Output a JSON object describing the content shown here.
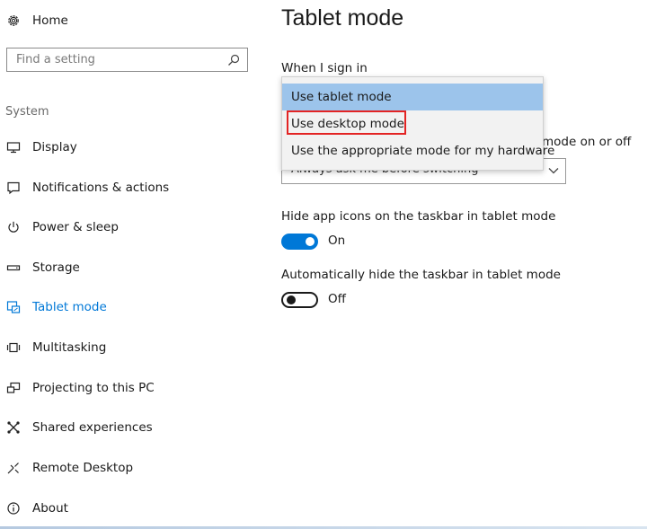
{
  "sidebar": {
    "home_label": "Home",
    "search_placeholder": "Find a setting",
    "section_label": "System",
    "items": [
      {
        "label": "Display",
        "icon": "monitor-icon"
      },
      {
        "label": "Notifications & actions",
        "icon": "notification-icon"
      },
      {
        "label": "Power & sleep",
        "icon": "power-icon"
      },
      {
        "label": "Storage",
        "icon": "storage-icon"
      },
      {
        "label": "Tablet mode",
        "icon": "tablet-mode-icon",
        "active": true
      },
      {
        "label": "Multitasking",
        "icon": "multitasking-icon"
      },
      {
        "label": "Projecting to this PC",
        "icon": "projecting-icon"
      },
      {
        "label": "Shared experiences",
        "icon": "shared-experiences-icon"
      },
      {
        "label": "Remote Desktop",
        "icon": "remote-desktop-icon"
      },
      {
        "label": "About",
        "icon": "info-icon"
      }
    ]
  },
  "main": {
    "title": "Tablet mode",
    "sign_in_label": "When I sign in",
    "switch_label_partial": "mode on or off",
    "switch_select_value": "Always ask me before switching",
    "dropdown_options": [
      "Use tablet mode",
      "Use desktop mode",
      "Use the appropriate mode for my hardware"
    ],
    "hide_icons_label": "Hide app icons on the taskbar in tablet mode",
    "hide_icons_state": "On",
    "auto_hide_label": "Automatically hide the taskbar in tablet mode",
    "auto_hide_state": "Off"
  },
  "colors": {
    "accent": "#0078d7",
    "dropdown_selected": "#9cc4eb",
    "highlight_border": "#e32424"
  }
}
